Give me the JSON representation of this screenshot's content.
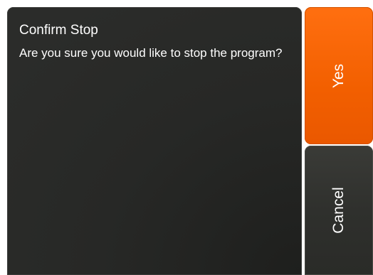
{
  "dialog": {
    "title": "Confirm Stop",
    "message": "Are you sure you would like to stop the program?"
  },
  "buttons": {
    "yes_label": "Yes",
    "cancel_label": "Cancel"
  },
  "colors": {
    "accent": "#f25f00",
    "panel": "#2a2b29",
    "cancel": "#2f302d"
  }
}
